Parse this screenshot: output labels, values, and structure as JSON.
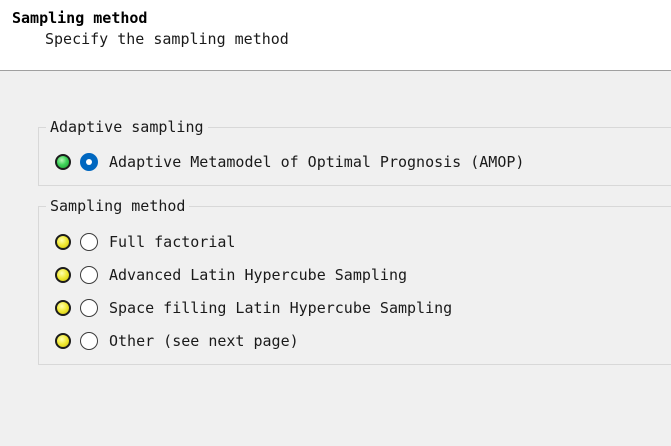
{
  "header": {
    "title": "Sampling method",
    "subtitle": "Specify the sampling method"
  },
  "groups": [
    {
      "legend": "Adaptive sampling",
      "options": [
        {
          "label": "Adaptive Metamodel of Optimal Prognosis (AMOP)",
          "status": "green",
          "selected": true
        }
      ]
    },
    {
      "legend": "Sampling method",
      "options": [
        {
          "label": "Full factorial",
          "status": "yellow",
          "selected": false
        },
        {
          "label": "Advanced Latin Hypercube Sampling",
          "status": "yellow",
          "selected": false
        },
        {
          "label": "Space filling Latin Hypercube Sampling",
          "status": "yellow",
          "selected": false
        },
        {
          "label": "Other (see next page)",
          "status": "yellow",
          "selected": false
        }
      ]
    }
  ],
  "colors": {
    "status_green": "#3fd35a",
    "status_yellow": "#f0e830",
    "radio_selected": "#0067c0"
  }
}
